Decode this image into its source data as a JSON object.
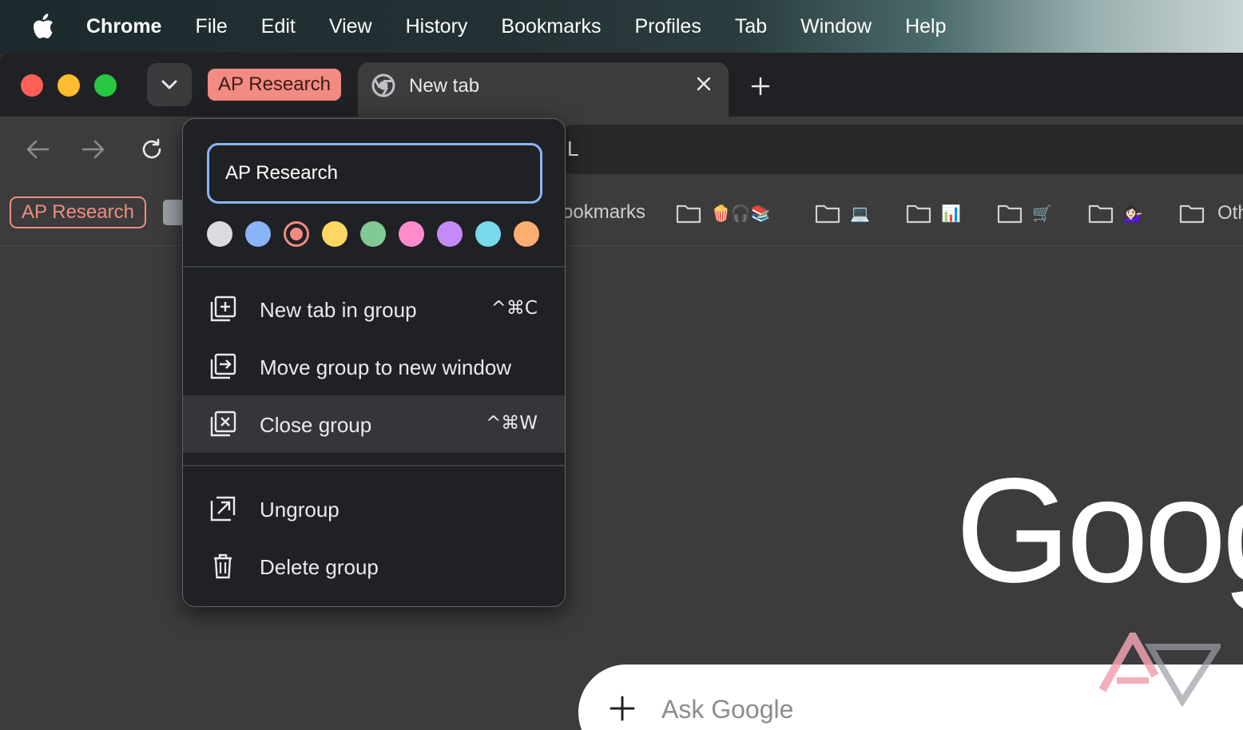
{
  "menubar": {
    "app_name": "Chrome",
    "items": [
      "File",
      "Edit",
      "View",
      "History",
      "Bookmarks",
      "Profiles",
      "Tab",
      "Window",
      "Help"
    ]
  },
  "tabstrip": {
    "group_label": "AP Research",
    "group_color": "#f28b82",
    "tab_title": "New tab"
  },
  "toolbar": {
    "omnibox_text": "L"
  },
  "bookmarks_bar": {
    "group_label": "AP Research",
    "partial_text": "ookmarks",
    "folders": [
      {
        "emoji": "🍿🎧📚"
      },
      {
        "emoji": "💻"
      },
      {
        "emoji": "📊"
      },
      {
        "emoji": "🛒"
      },
      {
        "emoji": "💁🏻‍♀️"
      },
      {
        "label": "Oth"
      }
    ]
  },
  "context_menu": {
    "group_name_value": "AP Research",
    "colors": [
      "#dadce0",
      "#8ab4f8",
      "#f28b82",
      "#fdd663",
      "#81c995",
      "#ff8bcb",
      "#c58af9",
      "#78d9ec",
      "#fcad70"
    ],
    "selected_color_index": 2,
    "items": [
      {
        "label": "New tab in group",
        "shortcut": "^⌘C",
        "icon": "new-tab-in-group-icon"
      },
      {
        "label": "Move group to new window",
        "shortcut": "",
        "icon": "move-to-window-icon"
      },
      {
        "label": "Close group",
        "shortcut": "^⌘W",
        "icon": "close-group-icon"
      },
      {
        "label": "Ungroup",
        "shortcut": "",
        "icon": "ungroup-icon"
      },
      {
        "label": "Delete group",
        "shortcut": "",
        "icon": "trash-icon"
      }
    ]
  },
  "ntp": {
    "logo_text": "Goog",
    "search_placeholder": "Ask Google"
  }
}
